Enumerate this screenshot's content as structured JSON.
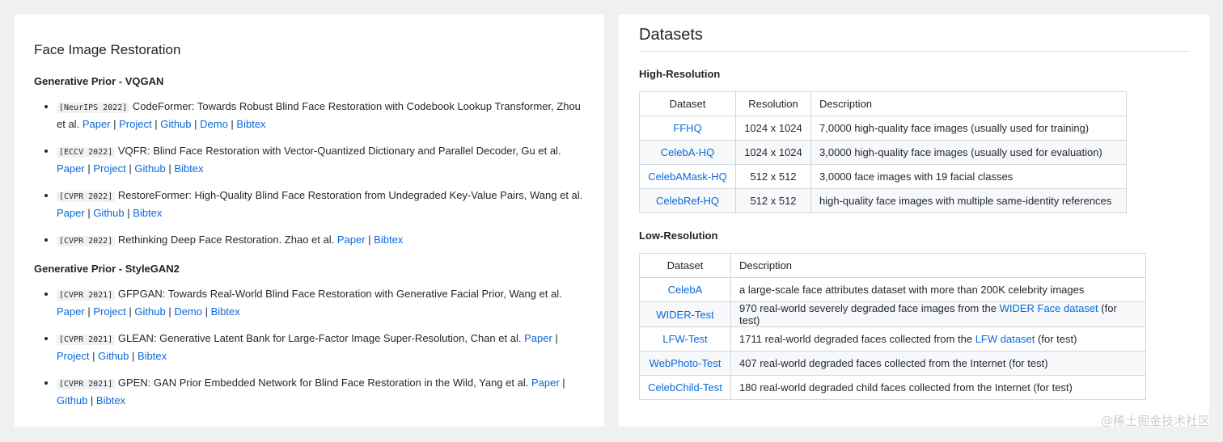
{
  "left": {
    "title": "Face Image Restoration",
    "groups": [
      {
        "heading": "Generative Prior - VQGAN",
        "items": [
          {
            "venue": "[NeurIPS 2022]",
            "text": "CodeFormer: Towards Robust Blind Face Restoration with Codebook Lookup Transformer, Zhou et al.",
            "links": [
              "Paper",
              "Project",
              "Github",
              "Demo",
              "Bibtex"
            ]
          },
          {
            "venue": "[ECCV 2022]",
            "text": "VQFR: Blind Face Restoration with Vector-Quantized Dictionary and Parallel Decoder, Gu et al.",
            "links": [
              "Paper",
              "Project",
              "Github",
              "Bibtex"
            ]
          },
          {
            "venue": "[CVPR 2022]",
            "text": "RestoreFormer: High-Quality Blind Face Restoration from Undegraded Key-Value Pairs, Wang et al.",
            "links": [
              "Paper",
              "Github",
              "Bibtex"
            ]
          },
          {
            "venue": "[CVPR 2022]",
            "text": "Rethinking Deep Face Restoration. Zhao et al.",
            "links": [
              "Paper",
              "Bibtex"
            ]
          }
        ]
      },
      {
        "heading": "Generative Prior - StyleGAN2",
        "items": [
          {
            "venue": "[CVPR 2021]",
            "text": "GFPGAN: Towards Real-World Blind Face Restoration with Generative Facial Prior, Wang et al.",
            "links": [
              "Paper",
              "Project",
              "Github",
              "Demo",
              "Bibtex"
            ]
          },
          {
            "venue": "[CVPR 2021]",
            "text": "GLEAN: Generative Latent Bank for Large-Factor Image Super-Resolution, Chan et al.",
            "links": [
              "Paper",
              "Project",
              "Github",
              "Bibtex"
            ]
          },
          {
            "venue": "[CVPR 2021]",
            "text": "GPEN: GAN Prior Embedded Network for Blind Face Restoration in the Wild, Yang et al.",
            "links": [
              "Paper",
              "Github",
              "Bibtex"
            ]
          }
        ]
      }
    ]
  },
  "right": {
    "title": "Datasets",
    "high_res": {
      "heading": "High-Resolution",
      "headers": [
        "Dataset",
        "Resolution",
        "Description"
      ],
      "rows": [
        {
          "dataset": "FFHQ",
          "resolution": "1024 x 1024",
          "description": "7,0000 high-quality face images (usually used for training)"
        },
        {
          "dataset": "CelebA-HQ",
          "resolution": "1024 x 1024",
          "description": "3,0000 high-quality face images (usually used for evaluation)"
        },
        {
          "dataset": "CelebAMask-HQ",
          "resolution": "512 x 512",
          "description": "3,0000 face images with 19 facial classes"
        },
        {
          "dataset": "CelebRef-HQ",
          "resolution": "512 x 512",
          "description": "high-quality face images with multiple same-identity references"
        }
      ]
    },
    "low_res": {
      "heading": "Low-Resolution",
      "headers": [
        "Dataset",
        "Description"
      ],
      "rows": [
        {
          "dataset": "CelebA",
          "pre": "a large-scale face attributes dataset with more than 200K celebrity images",
          "link": "",
          "post": ""
        },
        {
          "dataset": "WIDER-Test",
          "pre": "970 real-world severely degraded face images from the ",
          "link": "WIDER Face dataset",
          "post": " (for test)"
        },
        {
          "dataset": "LFW-Test",
          "pre": "1711 real-world degraded faces collected from the ",
          "link": "LFW dataset",
          "post": " (for test)"
        },
        {
          "dataset": "WebPhoto-Test",
          "pre": "407 real-world degraded faces collected from the Internet (for test)",
          "link": "",
          "post": ""
        },
        {
          "dataset": "CelebChild-Test",
          "pre": "180 real-world degraded child faces collected from the Internet (for test)",
          "link": "",
          "post": ""
        }
      ]
    }
  },
  "watermark": "@稀土掘金技术社区",
  "colors": {
    "link": "#0969da",
    "page_bg": "#f0f0f0",
    "card_bg": "#ffffff",
    "border": "#d0d7de"
  }
}
